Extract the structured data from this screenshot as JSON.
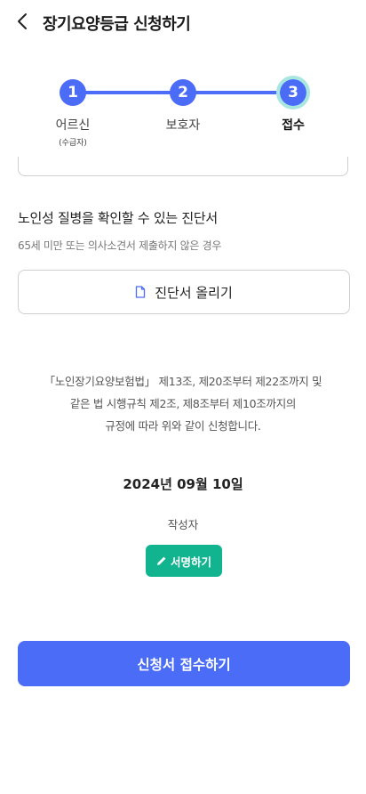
{
  "header": {
    "title": "장기요양등급 신청하기",
    "back_icon": "chevron-left-icon"
  },
  "stepper": {
    "accent_color": "#4a6cf7",
    "steps": [
      {
        "number": "1",
        "label": "어르신",
        "sublabel": "(수급자)"
      },
      {
        "number": "2",
        "label": "보호자"
      },
      {
        "number": "3",
        "label": "접수",
        "active": true
      }
    ]
  },
  "diagnosis": {
    "title": "노인성 질병을 확인할 수 있는 진단서",
    "subtitle": "65세 미만 또는 의사소견서 제출하지 않은 경우",
    "upload_icon": "document-icon",
    "upload_label": "진단서 올리기"
  },
  "legal": {
    "line1": "「노인장기요양보험법」 제13조, 제20조부터 제22조까지 및",
    "line2": "같은 법 시행규칙 제2조, 제8조부터 제10조까지의",
    "line3": "규정에 따라 위와 같이 신청합니다."
  },
  "signature": {
    "date": "2024년 09월 10일",
    "writer_label": "작성자",
    "sign_icon": "pencil-icon",
    "sign_label": "서명하기",
    "sign_color": "#12b38f"
  },
  "submit": {
    "label": "신청서 접수하기"
  }
}
